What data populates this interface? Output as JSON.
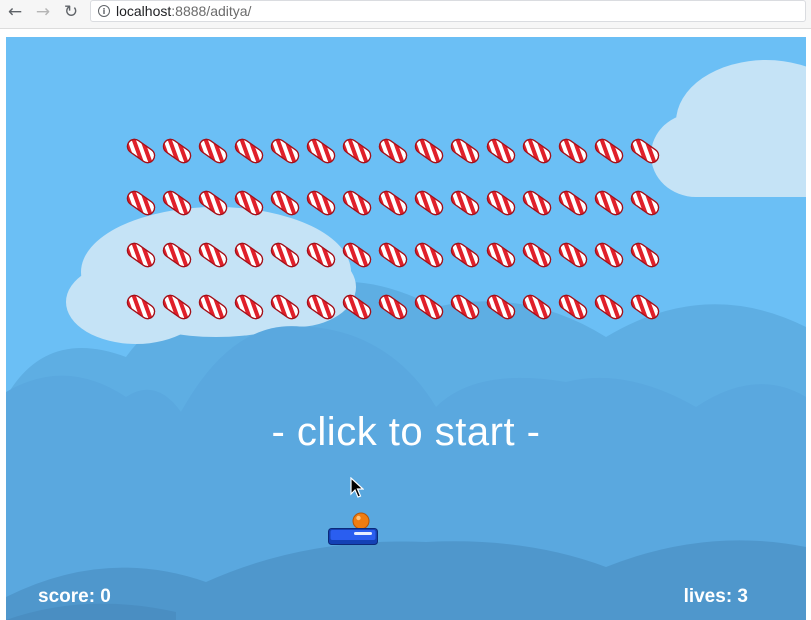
{
  "browser": {
    "url_host": "localhost",
    "url_rest": ":8888/aditya/",
    "back_icon": "arrow-left-icon",
    "forward_icon": "arrow-right-icon",
    "reload_icon": "reload-icon",
    "info_icon": "info-icon"
  },
  "game": {
    "start_prompt": "- click to start -",
    "score_label": "score: 0",
    "lives_label": "lives: 3",
    "brick_rows": 4,
    "brick_cols": 15,
    "brick_icon": "candy-icon",
    "colors": {
      "sky": "#6bbff5",
      "cloud": "#c5e3f6",
      "hills": "#5aa6dc",
      "candy_red": "#e0202a",
      "paddle": "#1e4fd6",
      "ball": "#f07d10"
    }
  }
}
